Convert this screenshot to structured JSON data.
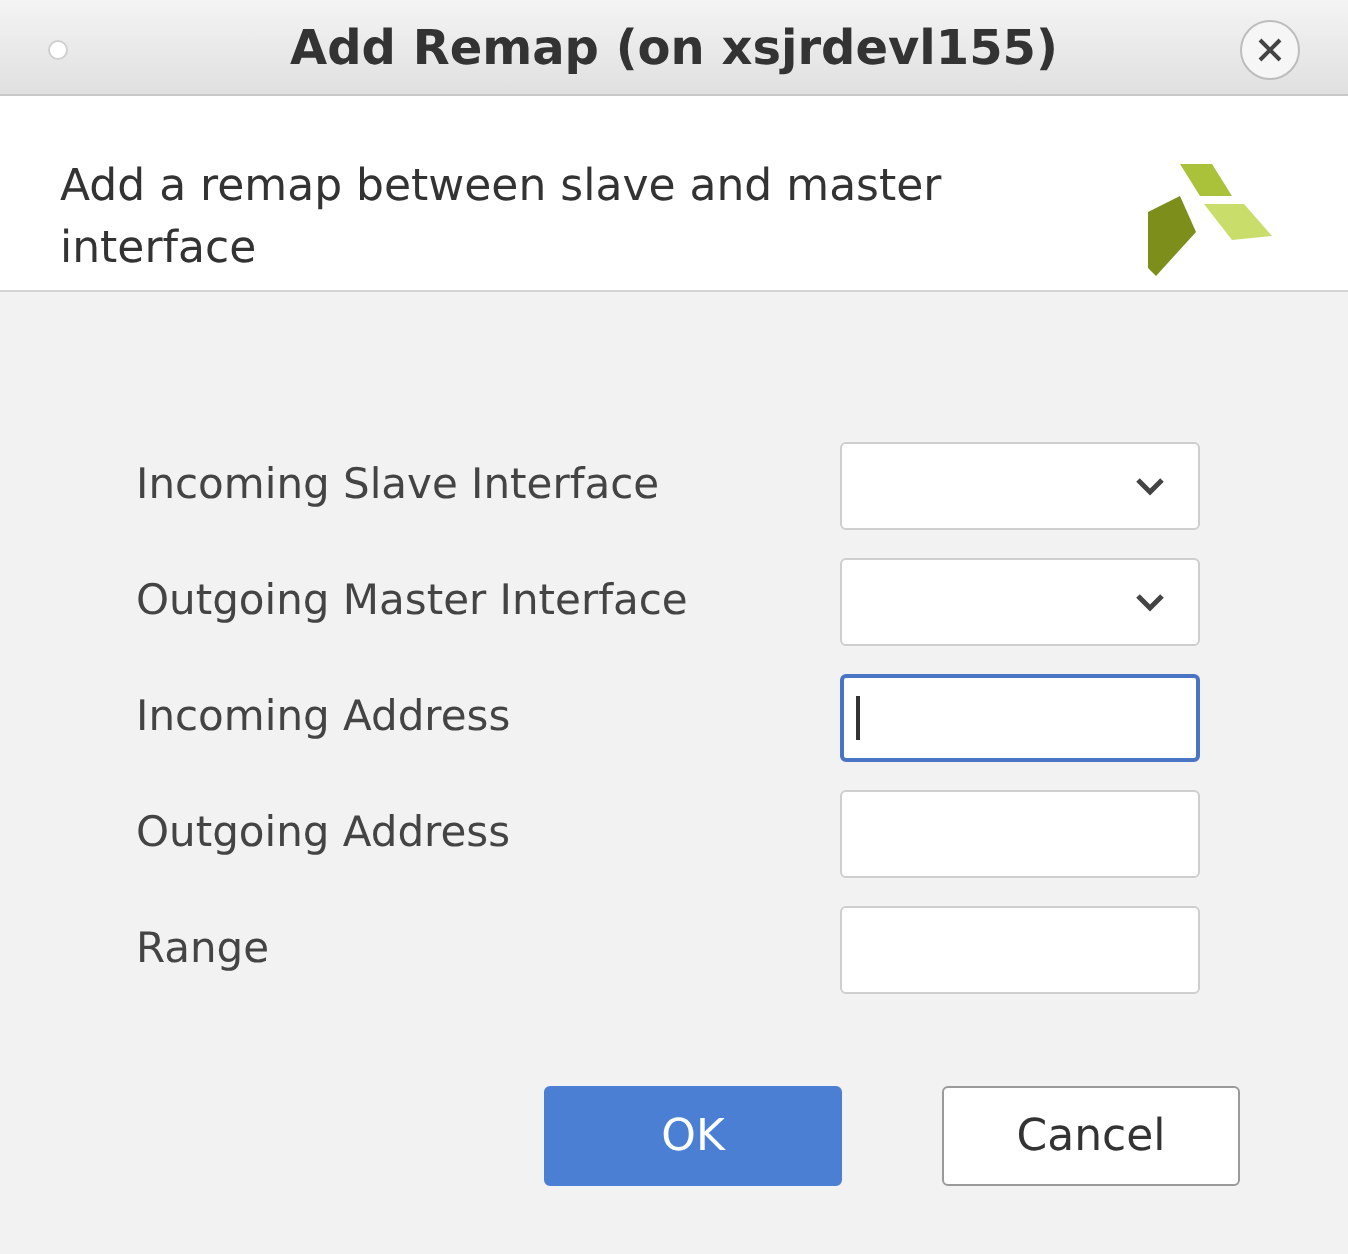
{
  "window": {
    "title": "Add Remap (on xsjrdevl155)"
  },
  "header": {
    "description": "Add a remap between slave and master interface"
  },
  "fields": [
    {
      "label": "Incoming Slave Interface",
      "kind": "dropdown",
      "focused": false
    },
    {
      "label": "Outgoing Master Interface",
      "kind": "dropdown",
      "focused": false
    },
    {
      "label": "Incoming Address",
      "kind": "text",
      "focused": true
    },
    {
      "label": "Outgoing Address",
      "kind": "text",
      "focused": false
    },
    {
      "label": "Range",
      "kind": "text",
      "focused": false
    }
  ],
  "buttons": [
    {
      "label": "OK",
      "kind": "primary"
    },
    {
      "label": "Cancel",
      "kind": "secondary"
    }
  ]
}
